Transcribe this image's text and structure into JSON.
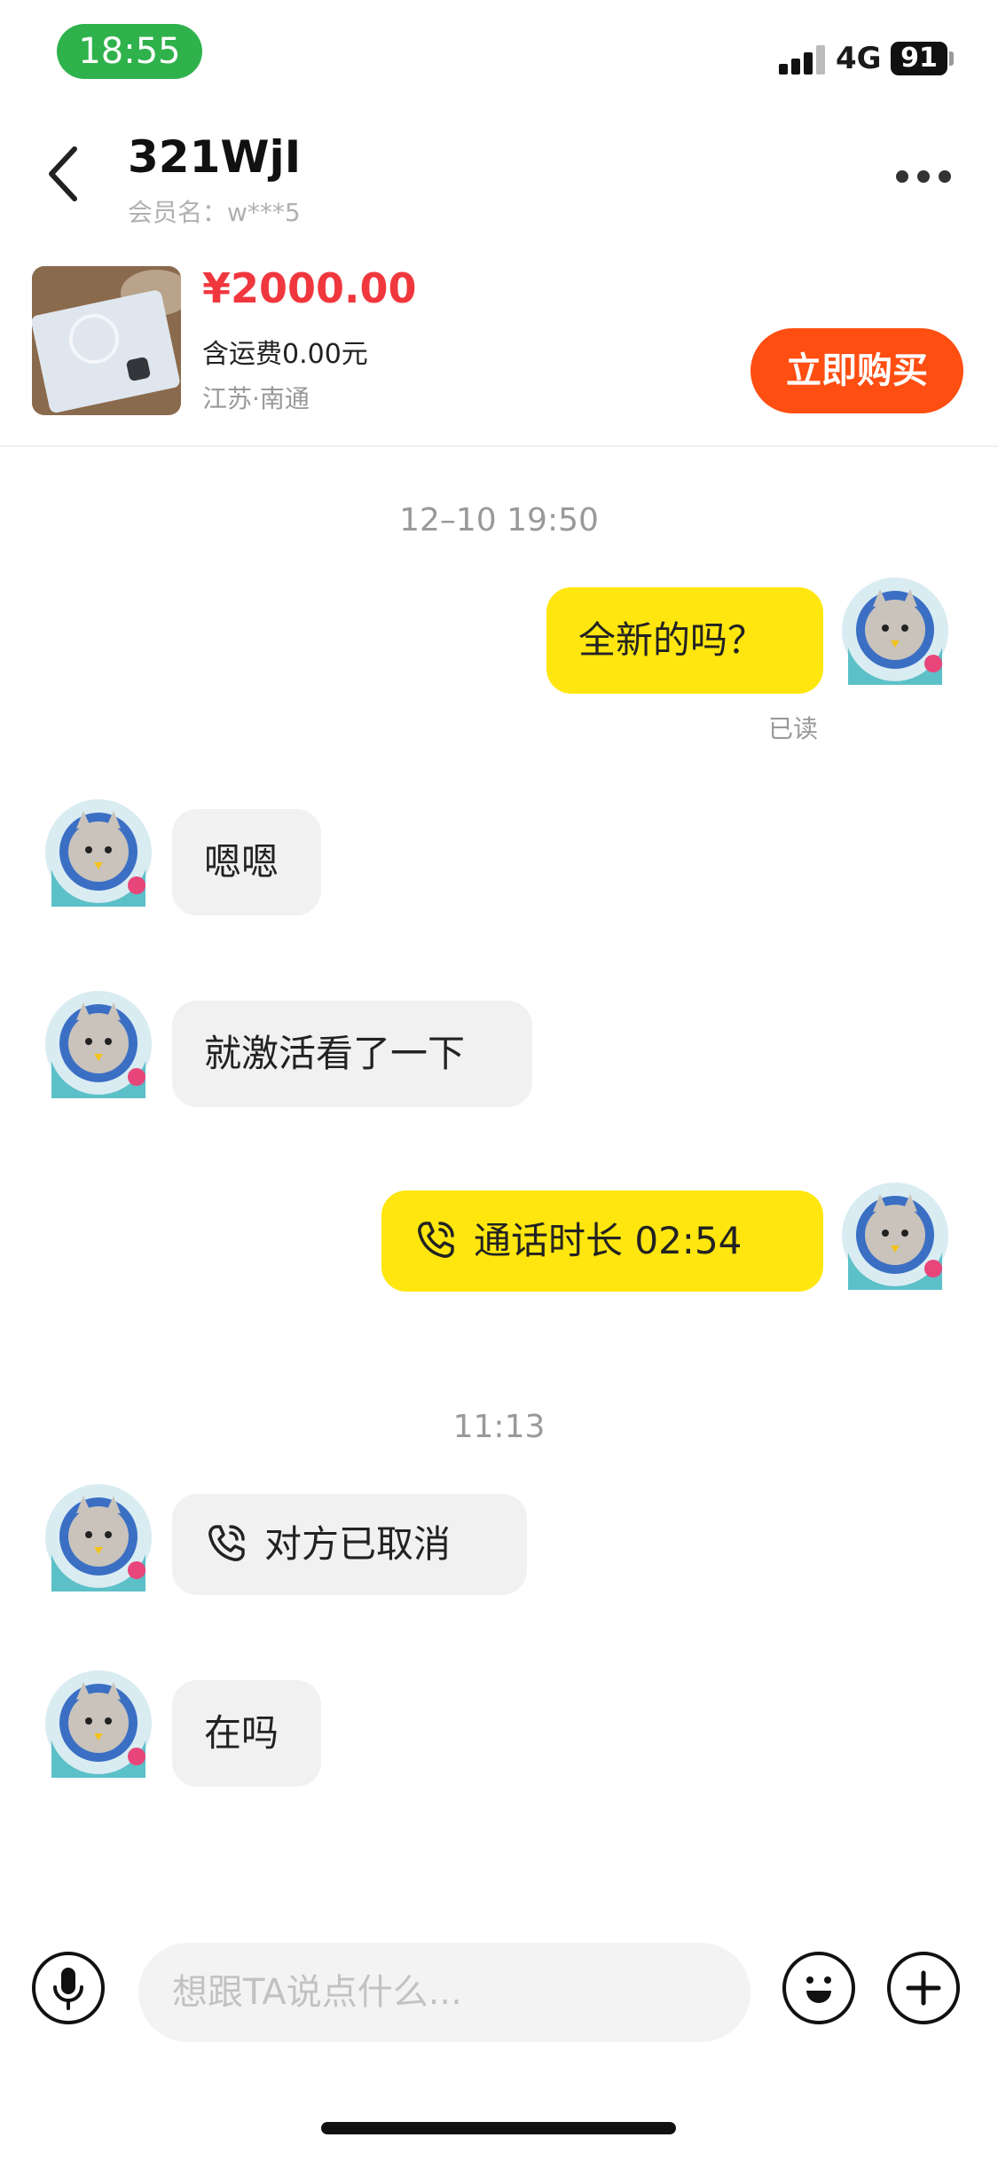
{
  "status_bar": {
    "time": "18:55",
    "network": "4G",
    "battery": "91"
  },
  "header": {
    "title": "321WjI",
    "subtitle": "会员名：w***5"
  },
  "product": {
    "price": "¥2000.00",
    "shipping": "含运费0.00元",
    "location": "江苏·南通",
    "buy_label": "立即购买"
  },
  "chat": {
    "timestamp_1": "12–10 19:50",
    "timestamp_2": "11:13",
    "messages": [
      {
        "side": "out",
        "text": "全新的吗？",
        "status": "已读"
      },
      {
        "side": "in",
        "text": "嗯嗯"
      },
      {
        "side": "in",
        "text": "就激活看了一下"
      },
      {
        "side": "out",
        "text": "通话时长 02:54",
        "icon": "phone-icon"
      },
      {
        "side": "in",
        "text": "对方已取消",
        "icon": "phone-icon"
      },
      {
        "side": "in",
        "text": "在吗"
      }
    ]
  },
  "composer": {
    "placeholder": "想跟TA说点什么..."
  },
  "colors": {
    "accent_yellow": "#ffe60f",
    "buy_orange": "#ff4e12",
    "price_red": "#f0373d",
    "time_green": "#2fb24c"
  }
}
